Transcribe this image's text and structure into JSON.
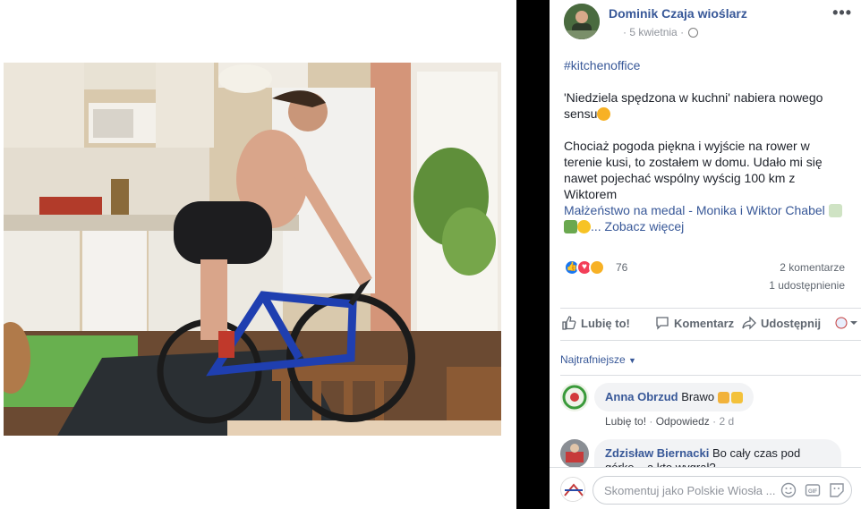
{
  "post": {
    "author": "Dominik Czaja wioślarz",
    "date": "5 kwietnia",
    "more_label": "•••",
    "hashtag": "#kitchenoffice",
    "line1": "'Niedziela spędzona w kuchni' nabiera nowego sensu",
    "line2": "Chociaż pogoda piękna i wyjście na rower w terenie kusi, to zostałem w domu. Udało mi się nawet pojechać wspólny wyścig 100 km z Wiktorem",
    "mention": "Małżeństwo na medal - Monika i Wiktor Chabel",
    "see_more": "... Zobacz więcej"
  },
  "photo": {
    "description_icon": "photo"
  },
  "reactions": {
    "count": "76",
    "comments": "2 komentarze",
    "shares": "1 udostępnienie"
  },
  "actions": {
    "like": "Lubię to!",
    "comment": "Komentarz",
    "share": "Udostępnij"
  },
  "sort": {
    "label": "Najtrafniejsze"
  },
  "comments": [
    {
      "name": "Anna Obrzud",
      "text": "Brawo",
      "like": "Lubię to!",
      "reply": "Odpowiedz",
      "time": "2 d"
    },
    {
      "name": "Zdzisław Biernacki",
      "text": "Bo cały czas pod górkę ...a kto wygrał?"
    }
  ],
  "composer": {
    "placeholder": "Skomentuj jako Polskie Wiosła ..."
  },
  "colors": {
    "link": "#385898",
    "divider": "#000000",
    "bubble": "#f2f3f5"
  }
}
